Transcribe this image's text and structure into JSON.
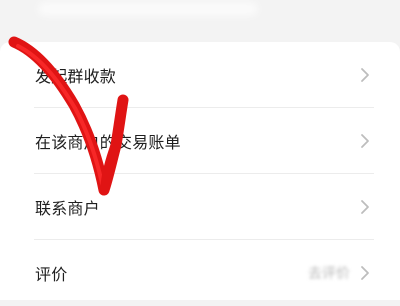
{
  "menu": {
    "items": [
      {
        "label": "发起群收款",
        "value": "",
        "icon": "chevron-right-icon"
      },
      {
        "label": "在该商户的交易账单",
        "value": "",
        "icon": "chevron-right-icon"
      },
      {
        "label": "联系商户",
        "value": "",
        "icon": "chevron-right-icon"
      },
      {
        "label": "评价",
        "value": "去评价",
        "icon": "chevron-right-icon"
      }
    ]
  },
  "annotation": {
    "shape": "hand-drawn-arrow",
    "color": "#e01414"
  }
}
